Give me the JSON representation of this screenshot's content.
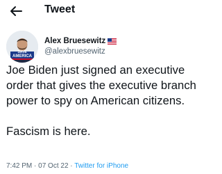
{
  "header": {
    "title": "Tweet",
    "back_icon": "arrow-left-icon"
  },
  "author": {
    "display_name": "Alex Bruesewitz",
    "handle": "@alexbruesewitz",
    "flag_icon": "us-flag-icon",
    "avatar_badge_text": [
      "SAVE",
      "AMERICA"
    ]
  },
  "tweet": {
    "body": "Joe Biden just signed an executive order that gives the executive branch power to spy on American citizens.\n\nFascism is here.",
    "time": "7:42 PM",
    "date": "07 Oct 22",
    "separator": "·",
    "source": "Twitter for iPhone"
  },
  "colors": {
    "text": "#0f1419",
    "secondary": "#536471",
    "link": "#1d9bf0",
    "background": "#ffffff"
  }
}
